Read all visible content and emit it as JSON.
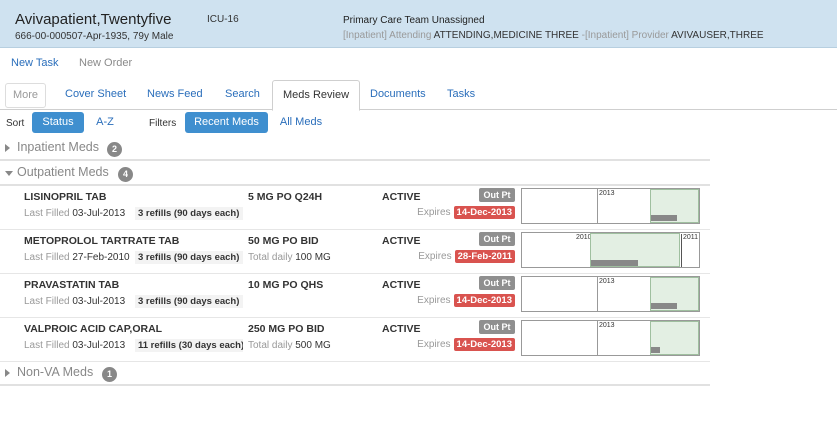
{
  "patient": {
    "name": "Avivapatient,Twentyfive",
    "ids": "666-00-000507-Apr-1935, 79y Male",
    "location": "ICU-16",
    "care_team": "Primary Care Team Unassigned",
    "attending_label": "[Inpatient] Attending",
    "attending_value": "ATTENDING,MEDICINE THREE",
    "provider_label": "-[Inpatient] Provider",
    "provider_value": "AVIVAUSER,THREE"
  },
  "actions": {
    "new_task": "New Task",
    "new_order": "New Order"
  },
  "tabs": {
    "more": "More",
    "items": [
      "Cover Sheet",
      "News Feed",
      "Search",
      "Meds Review",
      "Documents",
      "Tasks"
    ],
    "active": "Meds Review"
  },
  "toolbar": {
    "sort_label": "Sort",
    "sort_status": "Status",
    "sort_az": "A-Z",
    "filters_label": "Filters",
    "filter_recent": "Recent Meds",
    "filter_all": "All Meds"
  },
  "groups": {
    "inpatient": {
      "title": "Inpatient Meds",
      "count": "2"
    },
    "outpatient": {
      "title": "Outpatient Meds",
      "count": "4"
    },
    "nonva": {
      "title": "Non-VA Meds",
      "count": "1"
    }
  },
  "meds": [
    {
      "name": "LISINOPRIL TAB",
      "last_filled_label": "Last Filled",
      "last_filled": "03-Jul-2013",
      "refills": "3 refills (90 days each)",
      "dose": "5 MG PO Q24H",
      "daily_label": "",
      "daily_value": "",
      "status": "ACTIVE",
      "type": "Out Pt",
      "expires_label": "Expires",
      "expires": "14-Dec-2013",
      "timeline": {
        "label_left": "2013",
        "label_right": "",
        "supply_fraction": 0.15
      }
    },
    {
      "name": "METOPROLOL TARTRATE TAB",
      "last_filled_label": "Last Filled",
      "last_filled": "27-Feb-2010",
      "refills": "3 refills (90 days each)",
      "dose": "50 MG PO BID",
      "daily_label": "Total daily",
      "daily_value": "100 MG",
      "status": "ACTIVE",
      "type": "Out Pt",
      "expires_label": "Expires",
      "expires": "28-Feb-2011",
      "timeline": {
        "label_left": "2010",
        "label_right": "2011",
        "supply_fraction": 0.15
      }
    },
    {
      "name": "PRAVASTATIN TAB",
      "last_filled_label": "Last Filled",
      "last_filled": "03-Jul-2013",
      "refills": "3 refills (90 days each)",
      "dose": "10 MG PO QHS",
      "daily_label": "",
      "daily_value": "",
      "status": "ACTIVE",
      "type": "Out Pt",
      "expires_label": "Expires",
      "expires": "14-Dec-2013",
      "timeline": {
        "label_left": "2013",
        "label_right": "",
        "supply_fraction": 0.15
      }
    },
    {
      "name": "VALPROIC ACID CAP,ORAL",
      "last_filled_label": "Last Filled",
      "last_filled": "03-Jul-2013",
      "refills": "11 refills (30 days each)",
      "dose": "250 MG PO BID",
      "daily_label": "Total daily",
      "daily_value": "500 MG",
      "status": "ACTIVE",
      "type": "Out Pt",
      "expires_label": "Expires",
      "expires": "14-Dec-2013",
      "timeline": {
        "label_left": "2013",
        "label_right": "",
        "supply_fraction": 0.05
      }
    }
  ]
}
